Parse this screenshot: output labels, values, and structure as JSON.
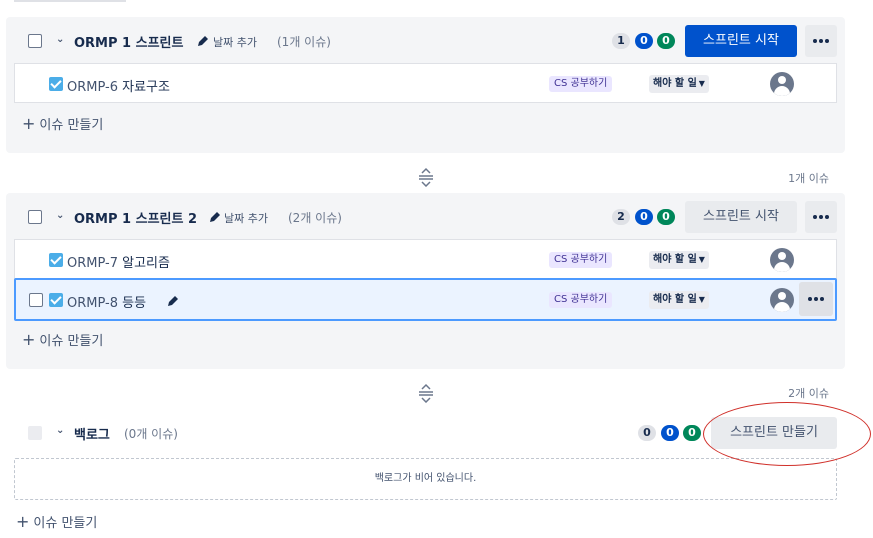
{
  "sprint1": {
    "name": "ORMP 1 스프린트",
    "date_add": "날짜 추가",
    "issue_count": "(1개 이슈)",
    "badges": [
      "1",
      "0",
      "0"
    ],
    "start_label": "스프린트 시작",
    "issues": [
      {
        "key": "ORMP-6",
        "title": "자료구조",
        "epic": "CS 공부하기",
        "status": "해야 할 일"
      }
    ],
    "create_label": "이슈 만들기"
  },
  "between1_count": "1개 이슈",
  "sprint2": {
    "name": "ORMP 1 스프린트 2",
    "date_add": "날짜 추가",
    "issue_count": "(2개 이슈)",
    "badges": [
      "2",
      "0",
      "0"
    ],
    "start_label": "스프린트 시작",
    "issues": [
      {
        "key": "ORMP-7",
        "title": "알고리즘",
        "epic": "CS 공부하기",
        "status": "해야 할 일"
      },
      {
        "key": "ORMP-8",
        "title": "등등",
        "epic": "CS 공부하기",
        "status": "해야 할 일"
      }
    ],
    "create_label": "이슈 만들기"
  },
  "between2_count": "2개 이슈",
  "backlog": {
    "name": "백로그",
    "issue_count": "(0개 이슈)",
    "badges": [
      "0",
      "0",
      "0"
    ],
    "create_sprint_label": "스프린트 만들기",
    "empty_text": "백로그가 비어 있습니다.",
    "create_label": "이슈 만들기"
  },
  "colors": {
    "primary": "#0052cc",
    "done_badge": "#00875a",
    "epic_bg": "#eae6ff",
    "epic_text": "#403294",
    "selected_border": "#4c9aff",
    "annotation": "#d0302a"
  },
  "icons": {
    "expand": "chevron-down-icon",
    "edit": "pencil-icon",
    "story": "checkbox-story-icon",
    "assignee": "avatar-icon",
    "drag": "drag-handle-icon",
    "more": "more-icon",
    "add": "plus-icon"
  }
}
